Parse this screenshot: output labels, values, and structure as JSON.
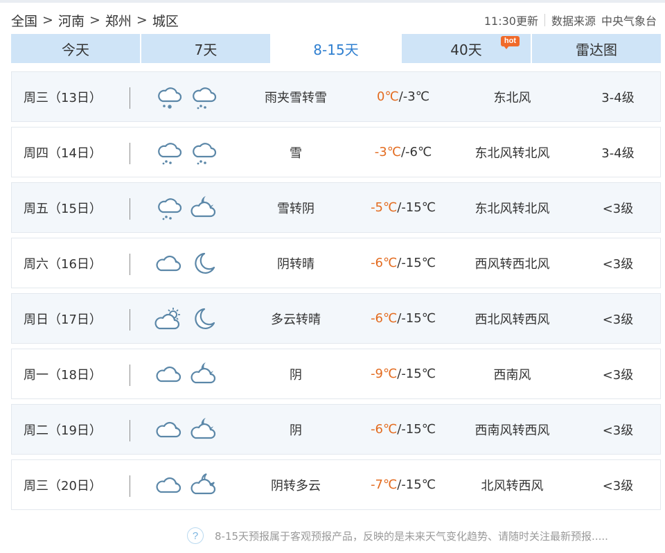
{
  "breadcrumb": [
    "全国",
    "河南",
    "郑州",
    "城区"
  ],
  "breadcrumb_sep": ">",
  "update_time": "11:30更新",
  "source_label": "数据来源",
  "source_name": "中央气象台",
  "tabs": [
    {
      "label": "今天",
      "active": false
    },
    {
      "label": "7天",
      "active": false
    },
    {
      "label": "8-15天",
      "active": true
    },
    {
      "label": "40天",
      "active": false,
      "badge": "hot"
    },
    {
      "label": "雷达图",
      "active": false
    }
  ],
  "colors": {
    "accent": "#2f7fd0",
    "tab_bg": "#cfe4f7",
    "temp_high": "#e36b1f",
    "badge": "#f06a2a",
    "icon_stroke": "#5b87a8"
  },
  "forecast": [
    {
      "date": "周三（13日）",
      "icon_day": "rain-snow-icon",
      "icon_night": "snow-icon",
      "desc": "雨夹雪转雪",
      "high": "0℃",
      "low": "-3℃",
      "wind": "东北风",
      "level": "3-4级"
    },
    {
      "date": "周四（14日）",
      "icon_day": "snow-icon",
      "icon_night": "snow-icon",
      "desc": "雪",
      "high": "-3℃",
      "low": "-6℃",
      "wind": "东北风转北风",
      "level": "3-4级"
    },
    {
      "date": "周五（15日）",
      "icon_day": "snow-icon",
      "icon_night": "cloudy-night-icon",
      "desc": "雪转阴",
      "high": "-5℃",
      "low": "-15℃",
      "wind": "东北风转北风",
      "level": "<3级"
    },
    {
      "date": "周六（16日）",
      "icon_day": "overcast-icon",
      "icon_night": "moon-icon",
      "desc": "阴转晴",
      "high": "-6℃",
      "low": "-15℃",
      "wind": "西风转西北风",
      "level": "<3级"
    },
    {
      "date": "周日（17日）",
      "icon_day": "partly-cloudy-day-icon",
      "icon_night": "moon-icon",
      "desc": "多云转晴",
      "high": "-6℃",
      "low": "-15℃",
      "wind": "西北风转西风",
      "level": "<3级"
    },
    {
      "date": "周一（18日）",
      "icon_day": "overcast-icon",
      "icon_night": "cloudy-night-icon",
      "desc": "阴",
      "high": "-9℃",
      "low": "-15℃",
      "wind": "西南风",
      "level": "<3级"
    },
    {
      "date": "周二（19日）",
      "icon_day": "overcast-icon",
      "icon_night": "cloudy-night-icon",
      "desc": "阴",
      "high": "-6℃",
      "low": "-15℃",
      "wind": "西南风转西风",
      "level": "<3级"
    },
    {
      "date": "周三（20日）",
      "icon_day": "overcast-icon",
      "icon_night": "partly-cloudy-night-icon",
      "desc": "阴转多云",
      "high": "-7℃",
      "low": "-15℃",
      "wind": "北风转西风",
      "level": "<3级"
    }
  ],
  "footnote_icon": "?",
  "footnote": "8-15天预报属于客观预报产品，反映的是未来天气变化趋势、请随时关注最新预报....."
}
